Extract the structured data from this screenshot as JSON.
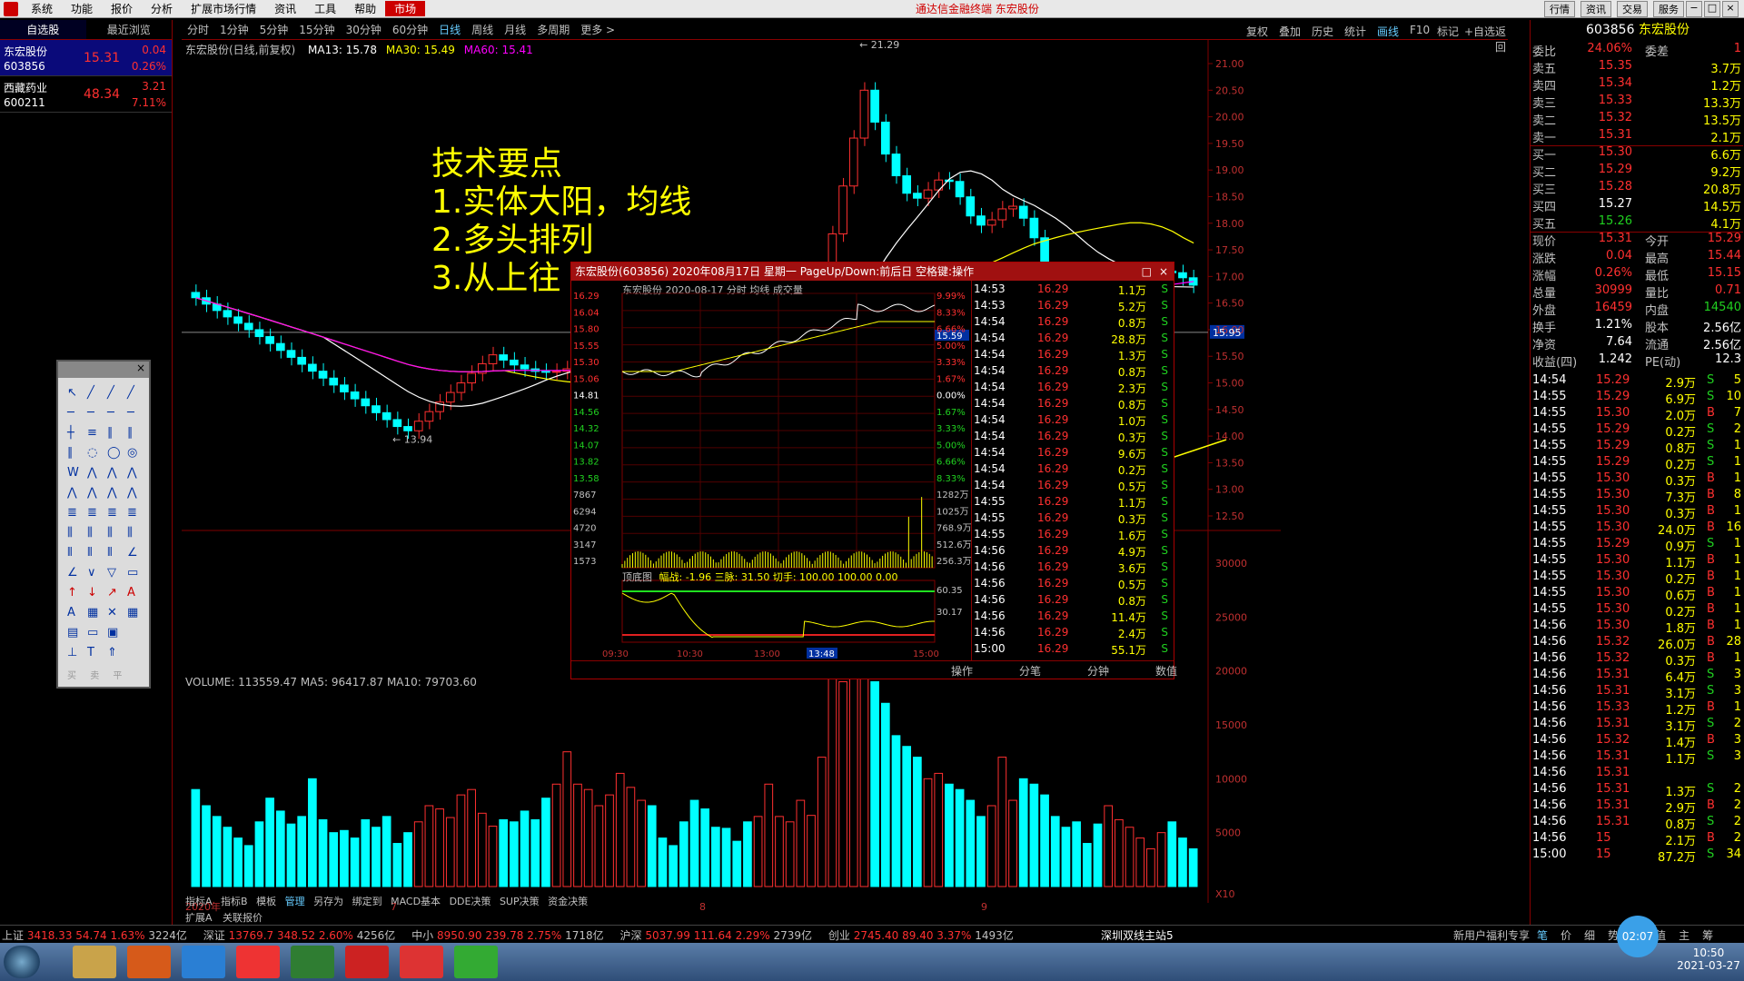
{
  "menubar": {
    "items": [
      "系统",
      "功能",
      "报价",
      "分析",
      "扩展市场行情",
      "资讯",
      "工具",
      "帮助"
    ],
    "market": "市场",
    "title": "通达信金融终端 东宏股份",
    "right_buttons": [
      "行情",
      "资讯",
      "交易",
      "服务"
    ]
  },
  "left_panel": {
    "tabs": [
      "自选股",
      "最近浏览"
    ],
    "stocks": [
      {
        "name": "东宏股份",
        "code": "603856",
        "price": "15.31",
        "change": "0.04",
        "pct": "0.26%"
      },
      {
        "name": "西藏药业",
        "code": "600211",
        "price": "48.34",
        "change": "3.21",
        "pct": "7.11%"
      }
    ]
  },
  "chart_toolbar": {
    "periods": [
      "分时",
      "1分钟",
      "5分钟",
      "15分钟",
      "30分钟",
      "60分钟",
      "日线",
      "周线",
      "月线",
      "多周期",
      "更多 >"
    ],
    "active": "日线",
    "right": [
      "复权",
      "叠加",
      "历史",
      "统计",
      "画线",
      "F10",
      "标记",
      "+自选",
      "返回"
    ]
  },
  "chart_info": {
    "title": "东宏股份(日线,前复权)",
    "ma13": "MA13: 15.78",
    "ma30": "MA30: 15.49",
    "ma60": "MA60: 15.41"
  },
  "annotation": {
    "lines": [
      "技术要点",
      "1.实体大阳，均线",
      "2.多头排列",
      "3.从上往"
    ]
  },
  "price_axis": [
    "21.00",
    "20.50",
    "20.00",
    "19.50",
    "19.00",
    "18.50",
    "18.00",
    "17.50",
    "17.00",
    "16.50",
    "16.00",
    "15.50",
    "15.00",
    "14.50",
    "14.00",
    "13.50",
    "13.00",
    "12.50"
  ],
  "price_marks": {
    "high": "21.29",
    "low": "13.94",
    "current": "15.95"
  },
  "volume": {
    "info": "VOLUME: 113559.47  MA5: 96417.87  MA10: 79703.60",
    "axis": [
      "30000",
      "25000",
      "20000",
      "15000",
      "10000",
      "5000",
      "X10"
    ]
  },
  "chart_data": {
    "type": "bar",
    "title": "东宏股份(日线,前复权)",
    "series": [
      {
        "name": "VOLUME",
        "values": [
          9000,
          7500,
          6500,
          5500,
          4500,
          3800,
          6000,
          8200,
          7000,
          5800,
          6500,
          10000,
          6200,
          5000,
          5200,
          4500,
          6200,
          5500,
          6500,
          4000,
          5000,
          6000,
          7500,
          7200,
          6400,
          8500,
          9000,
          6800,
          5600,
          6200,
          6000,
          7000,
          6200,
          8200,
          9500,
          12500,
          9500,
          9000,
          7500,
          8500,
          10500,
          9200,
          8000,
          7500,
          4500,
          3800,
          6000,
          8000,
          7200,
          5500,
          5400,
          4200,
          6000,
          6500,
          9500,
          6500,
          6000,
          8000,
          6600,
          12000,
          20000,
          19000,
          21000,
          29500,
          19000,
          17000,
          14000,
          13000,
          12000,
          10000,
          10500,
          9500,
          9000,
          8000,
          6500,
          7500,
          12000,
          8000,
          10000,
          9500,
          8500,
          6500,
          5500,
          6000,
          4000,
          5800,
          7500,
          6200,
          5500,
          4500,
          3500,
          5000,
          6000,
          4500,
          3500
        ]
      }
    ],
    "xlabel": "",
    "ylabel": "",
    "x_ticks": [
      "2020年",
      "7",
      "8",
      "9"
    ],
    "ylim": [
      0,
      30000
    ]
  },
  "bottom_indicators": [
    "指标A",
    "指标B",
    "模板",
    "管理",
    "另存为",
    "绑定到",
    "MACD基本",
    "DDE决策",
    "SUP决策",
    "资金决策"
  ],
  "bottom_tabs": [
    "扩展A",
    "关联报价"
  ],
  "right_panel": {
    "code": "603856",
    "name": "东宏股份",
    "weibi": {
      "label": "委比",
      "value": "24.06%",
      "label2": "委差",
      "value2": "1"
    },
    "sells": [
      {
        "label": "卖五",
        "price": "15.35",
        "vol": "3.7万"
      },
      {
        "label": "卖四",
        "price": "15.34",
        "vol": "1.2万"
      },
      {
        "label": "卖三",
        "price": "15.33",
        "vol": "13.3万"
      },
      {
        "label": "卖二",
        "price": "15.32",
        "vol": "13.5万"
      },
      {
        "label": "卖一",
        "price": "15.31",
        "vol": "2.1万"
      }
    ],
    "buys": [
      {
        "label": "买一",
        "price": "15.30",
        "vol": "6.6万"
      },
      {
        "label": "买二",
        "price": "15.29",
        "vol": "9.2万"
      },
      {
        "label": "买三",
        "price": "15.28",
        "vol": "20.8万"
      },
      {
        "label": "买四",
        "price": "15.27",
        "vol": "14.5万"
      },
      {
        "label": "买五",
        "price": "15.26",
        "vol": "4.1万"
      }
    ],
    "stats": [
      {
        "l1": "现价",
        "v1": "15.31",
        "l2": "今开",
        "v2": "15.29"
      },
      {
        "l1": "涨跌",
        "v1": "0.04",
        "l2": "最高",
        "v2": "15.44"
      },
      {
        "l1": "涨幅",
        "v1": "0.26%",
        "l2": "最低",
        "v2": "15.15"
      },
      {
        "l1": "总量",
        "v1": "30999",
        "l2": "量比",
        "v2": "0.71"
      },
      {
        "l1": "外盘",
        "v1": "16459",
        "l2": "内盘",
        "v2": "14540"
      },
      {
        "l1": "换手",
        "v1": "1.21%",
        "l2": "股本",
        "v2": "2.56亿"
      },
      {
        "l1": "净资",
        "v1": "7.64",
        "l2": "流通",
        "v2": "2.56亿"
      },
      {
        "l1": "收益(四)",
        "v1": "1.242",
        "l2": "PE(动)",
        "v2": "12.3"
      }
    ],
    "ticks": [
      {
        "t": "14:54",
        "p": "15.29",
        "v": "2.9万",
        "s": "S",
        "n": "5"
      },
      {
        "t": "14:55",
        "p": "15.29",
        "v": "6.9万",
        "s": "S",
        "n": "10"
      },
      {
        "t": "14:55",
        "p": "15.30",
        "v": "2.0万",
        "s": "B",
        "n": "7"
      },
      {
        "t": "14:55",
        "p": "15.29",
        "v": "0.2万",
        "s": "S",
        "n": "2"
      },
      {
        "t": "14:55",
        "p": "15.29",
        "v": "0.8万",
        "s": "S",
        "n": "1"
      },
      {
        "t": "14:55",
        "p": "15.29",
        "v": "0.2万",
        "s": "S",
        "n": "1"
      },
      {
        "t": "14:55",
        "p": "15.30",
        "v": "0.3万",
        "s": "B",
        "n": "1"
      },
      {
        "t": "14:55",
        "p": "15.30",
        "v": "7.3万",
        "s": "B",
        "n": "8"
      },
      {
        "t": "14:55",
        "p": "15.30",
        "v": "0.3万",
        "s": "B",
        "n": "1"
      },
      {
        "t": "14:55",
        "p": "15.30",
        "v": "24.0万",
        "s": "B",
        "n": "16"
      },
      {
        "t": "14:55",
        "p": "15.29",
        "v": "0.9万",
        "s": "S",
        "n": "1"
      },
      {
        "t": "14:55",
        "p": "15.30",
        "v": "1.1万",
        "s": "B",
        "n": "1"
      },
      {
        "t": "14:55",
        "p": "15.30",
        "v": "0.2万",
        "s": "B",
        "n": "1"
      },
      {
        "t": "14:55",
        "p": "15.30",
        "v": "0.6万",
        "s": "B",
        "n": "1"
      },
      {
        "t": "14:55",
        "p": "15.30",
        "v": "0.2万",
        "s": "B",
        "n": "1"
      },
      {
        "t": "14:56",
        "p": "15.30",
        "v": "1.8万",
        "s": "B",
        "n": "1"
      },
      {
        "t": "14:56",
        "p": "15.32",
        "v": "26.0万",
        "s": "B",
        "n": "28"
      },
      {
        "t": "14:56",
        "p": "15.32",
        "v": "0.3万",
        "s": "B",
        "n": "1"
      },
      {
        "t": "14:56",
        "p": "15.31",
        "v": "6.4万",
        "s": "S",
        "n": "3"
      },
      {
        "t": "14:56",
        "p": "15.31",
        "v": "3.1万",
        "s": "S",
        "n": "3"
      },
      {
        "t": "14:56",
        "p": "15.33",
        "v": "1.2万",
        "s": "B",
        "n": "1"
      },
      {
        "t": "14:56",
        "p": "15.31",
        "v": "3.1万",
        "s": "S",
        "n": "2"
      },
      {
        "t": "14:56",
        "p": "15.32",
        "v": "1.4万",
        "s": "B",
        "n": "3"
      },
      {
        "t": "14:56",
        "p": "15.31",
        "v": "1.1万",
        "s": "S",
        "n": "3"
      },
      {
        "t": "14:56",
        "p": "15.31",
        "v": "",
        "s": "",
        "n": ""
      },
      {
        "t": "14:56",
        "p": "15.31",
        "v": "1.3万",
        "s": "S",
        "n": "2"
      },
      {
        "t": "14:56",
        "p": "15.31",
        "v": "2.9万",
        "s": "B",
        "n": "2"
      },
      {
        "t": "14:56",
        "p": "15.31",
        "v": "0.8万",
        "s": "S",
        "n": "2"
      },
      {
        "t": "14:56",
        "p": "15",
        "v": "2.1万",
        "s": "B",
        "n": "2"
      },
      {
        "t": "15:00",
        "p": "15",
        "v": "87.2万",
        "s": "S",
        "n": "34"
      }
    ],
    "bottom_tabs": [
      "笔",
      "价",
      "细",
      "势",
      "联",
      "值",
      "主",
      "筹"
    ],
    "news": "新用户福利专享"
  },
  "popup": {
    "title": "东宏股份(603856) 2020年08月17日 星期一  PageUp/Down:前后日 空格键:操作",
    "subtitle": "东宏股份  2020-08-17 分时  均线  成交量",
    "left_axis": [
      "16.29",
      "16.04",
      "15.80",
      "15.55",
      "15.30",
      "15.06",
      "14.81",
      "14.56",
      "14.32",
      "14.07",
      "13.82",
      "13.58",
      "7867",
      "6294",
      "4720",
      "3147",
      "1573"
    ],
    "right_axis": [
      "9.99%",
      "8.33%",
      "6.66%",
      "5.00%",
      "3.33%",
      "1.67%",
      "0.00%",
      "1.67%",
      "3.33%",
      "5.00%",
      "6.66%",
      "8.33%",
      "1282万",
      "1025万",
      "768.9万",
      "512.6万",
      "256.3万"
    ],
    "current_tag": "15.59",
    "lower_label": "顶底图",
    "lower_info": "幅战: -1.96  三脉: 31.50  切手: 100.00  100.00  0.00",
    "lower_axis": [
      "60.35",
      "30.17"
    ],
    "time_axis": [
      "09:30",
      "10:30",
      "13:00",
      "13:48",
      "15:00"
    ],
    "tabs": [
      "操作",
      "分笔",
      "分钟",
      "数值"
    ],
    "ticks": [
      {
        "t": "14:53",
        "p": "16.29",
        "v": "1.1万",
        "s": "S"
      },
      {
        "t": "14:53",
        "p": "16.29",
        "v": "5.2万",
        "s": "S"
      },
      {
        "t": "14:54",
        "p": "16.29",
        "v": "0.8万",
        "s": "S"
      },
      {
        "t": "14:54",
        "p": "16.29",
        "v": "28.8万",
        "s": "S"
      },
      {
        "t": "14:54",
        "p": "16.29",
        "v": "1.3万",
        "s": "S"
      },
      {
        "t": "14:54",
        "p": "16.29",
        "v": "0.8万",
        "s": "S"
      },
      {
        "t": "14:54",
        "p": "16.29",
        "v": "2.3万",
        "s": "S"
      },
      {
        "t": "14:54",
        "p": "16.29",
        "v": "0.8万",
        "s": "S"
      },
      {
        "t": "14:54",
        "p": "16.29",
        "v": "1.0万",
        "s": "S"
      },
      {
        "t": "14:54",
        "p": "16.29",
        "v": "0.3万",
        "s": "S"
      },
      {
        "t": "14:54",
        "p": "16.29",
        "v": "9.6万",
        "s": "S"
      },
      {
        "t": "14:54",
        "p": "16.29",
        "v": "0.2万",
        "s": "S"
      },
      {
        "t": "14:54",
        "p": "16.29",
        "v": "0.5万",
        "s": "S"
      },
      {
        "t": "14:55",
        "p": "16.29",
        "v": "1.1万",
        "s": "S"
      },
      {
        "t": "14:55",
        "p": "16.29",
        "v": "0.3万",
        "s": "S"
      },
      {
        "t": "14:55",
        "p": "16.29",
        "v": "1.6万",
        "s": "S"
      },
      {
        "t": "14:56",
        "p": "16.29",
        "v": "4.9万",
        "s": "S"
      },
      {
        "t": "14:56",
        "p": "16.29",
        "v": "3.6万",
        "s": "S"
      },
      {
        "t": "14:56",
        "p": "16.29",
        "v": "0.5万",
        "s": "S"
      },
      {
        "t": "14:56",
        "p": "16.29",
        "v": "0.8万",
        "s": "S"
      },
      {
        "t": "14:56",
        "p": "16.29",
        "v": "11.4万",
        "s": "S"
      },
      {
        "t": "14:56",
        "p": "16.29",
        "v": "2.4万",
        "s": "S"
      },
      {
        "t": "15:00",
        "p": "16.29",
        "v": "55.1万",
        "s": "S"
      }
    ]
  },
  "status_bar": {
    "items": [
      {
        "name": "上证",
        "val": "3418.33",
        "chg": "54.74",
        "pct": "1.63%",
        "amt": "3224亿"
      },
      {
        "name": "深证",
        "val": "13769.7",
        "chg": "348.52",
        "pct": "2.60%",
        "amt": "4256亿"
      },
      {
        "name": "中小",
        "val": "8950.90",
        "chg": "239.78",
        "pct": "2.75%",
        "amt": "1718亿"
      },
      {
        "name": "沪深",
        "val": "5037.99",
        "chg": "111.64",
        "pct": "2.29%",
        "amt": "2739亿"
      },
      {
        "name": "创业",
        "val": "2745.40",
        "chg": "89.40",
        "pct": "3.37%",
        "amt": "1493亿"
      }
    ],
    "server": "深圳双线主站5"
  },
  "taskbar": {
    "time": "10:50",
    "date": "2021-03-27",
    "badge": "02:07"
  },
  "toolbox": {
    "bottom_labels": [
      "买",
      "卖",
      "平"
    ]
  },
  "colors": {
    "up": "#ff3030",
    "down": "#00ffff",
    "ma13": "#ffffff",
    "ma30": "#ffff00",
    "ma60": "#ff00ff",
    "grid": "#800000"
  }
}
